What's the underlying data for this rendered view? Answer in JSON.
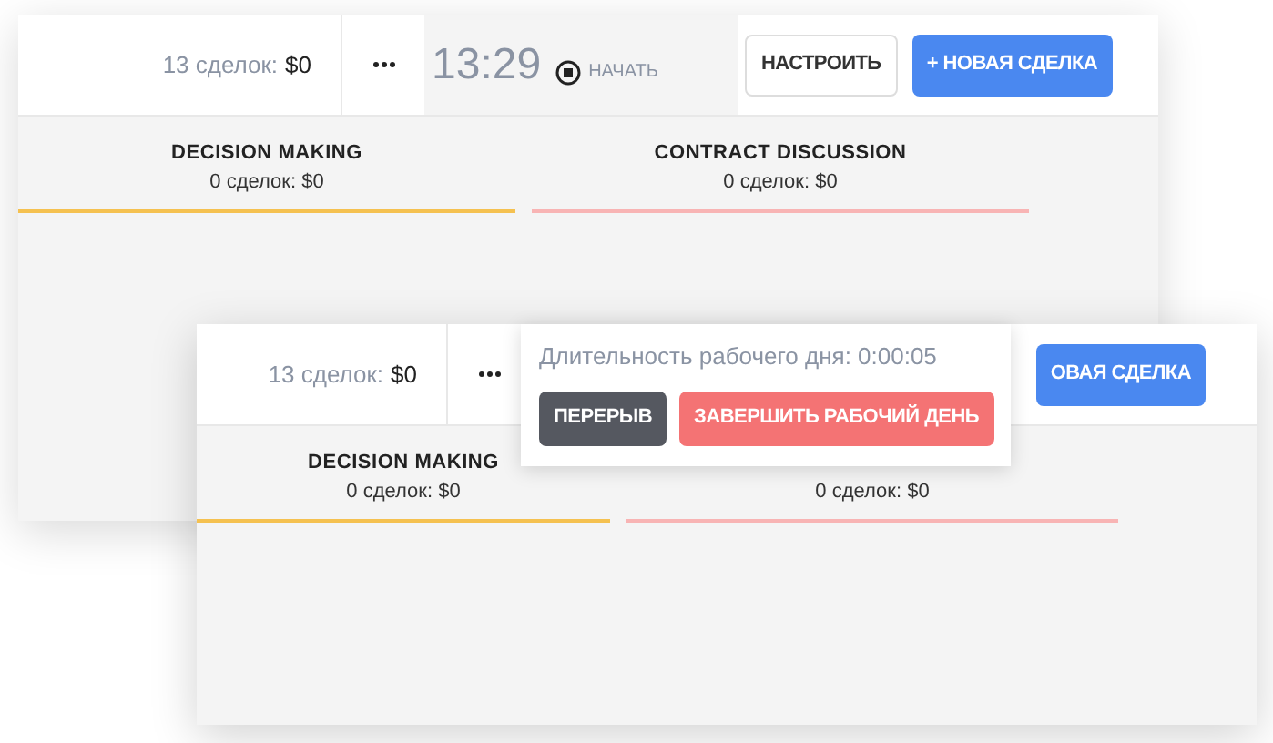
{
  "windows": [
    {
      "deal_count": "13 сделок:",
      "deal_sum": "$0",
      "timer": {
        "time": "13:29",
        "action": "НАЧАТЬ"
      },
      "buttons": [
        {
          "label": "НАСТРОИТЬ",
          "kind": "outline"
        },
        {
          "label": "+ НОВАЯ СДЕЛКА",
          "kind": "primary"
        }
      ],
      "stages": [
        {
          "title": "DECISION MAKING",
          "summary": "0 сделок: $0",
          "color": "#f5c150"
        },
        {
          "title": "CONTRACT DISCUSSION",
          "summary": "0 сделок: $0",
          "color": "#f8b4b4"
        }
      ]
    },
    {
      "deal_count": "13 сделок:",
      "deal_sum": "$0",
      "buttons": [
        {
          "label": "ОВАЯ СДЕЛКА",
          "kind": "primary"
        }
      ],
      "stages": [
        {
          "title": "DECISION MAKING",
          "summary": "0 сделок: $0",
          "color": "#f5c150"
        },
        {
          "summary": "0 сделок: $0",
          "color": "#f8b4b4"
        }
      ],
      "popup": {
        "text": "Длительность рабочего дня: 0:00:05",
        "buttons": [
          {
            "label": "ПЕРЕРЫВ",
            "kind": "dark"
          },
          {
            "label": "ЗАВЕРШИТЬ РАБОЧИЙ ДЕНЬ",
            "kind": "danger"
          }
        ]
      }
    }
  ]
}
